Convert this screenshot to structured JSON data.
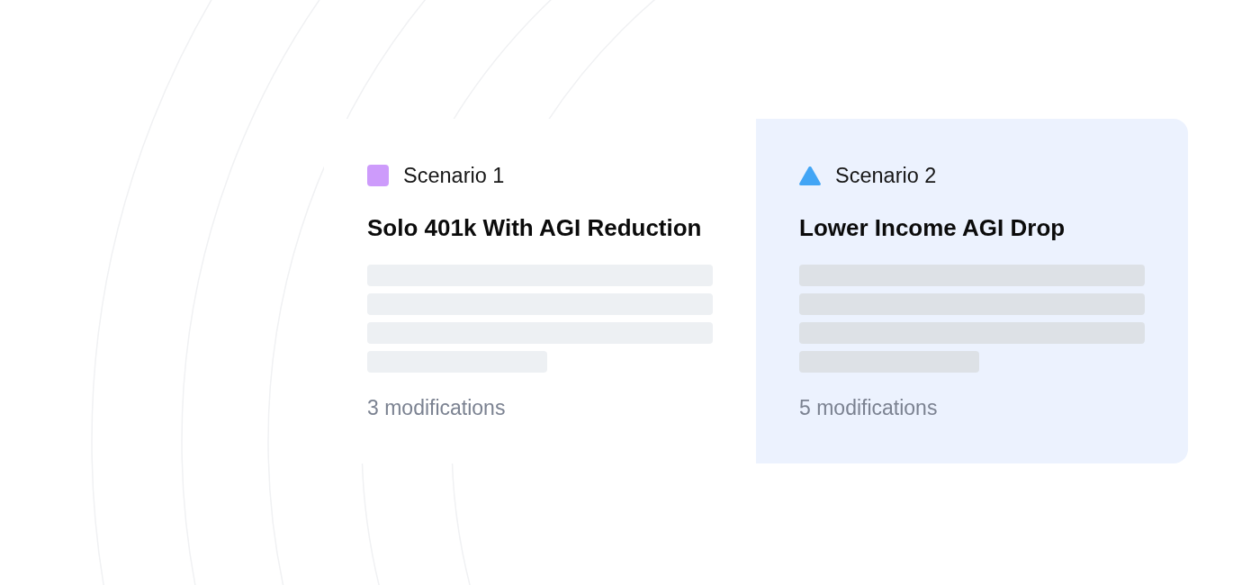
{
  "scenarios": [
    {
      "selected": false,
      "marker": {
        "kind": "square",
        "color": "#cd9bfb"
      },
      "label": "Scenario 1",
      "title": "Solo 401k With AGI Reduction",
      "modifications": "3 modifications"
    },
    {
      "selected": true,
      "marker": {
        "kind": "triangle",
        "color": "#42a5f5"
      },
      "label": "Scenario 2",
      "title": "Lower Income AGI Drop",
      "modifications": "5 modifications"
    }
  ]
}
